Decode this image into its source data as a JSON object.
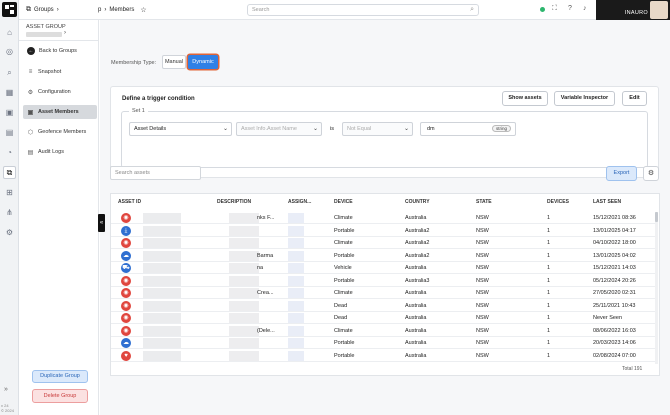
{
  "app": {
    "version": "v 24",
    "copyright": "© 2024"
  },
  "topbar": {
    "breadcrumb_groups": "Groups",
    "breadcrumb_partial": "p",
    "breadcrumb_members": "Members",
    "search_placeholder": "Search",
    "user_name": "INAURO"
  },
  "sidebar": {
    "asset_group_label": "ASSET GROUP",
    "items": [
      {
        "label": "Back to Groups"
      },
      {
        "label": "Snapshot"
      },
      {
        "label": "Configuration"
      },
      {
        "label": "Asset Members"
      },
      {
        "label": "Geofence Members"
      },
      {
        "label": "Audit Logs"
      }
    ],
    "duplicate_label": "Duplicate Group",
    "delete_label": "Delete Group"
  },
  "membership": {
    "label": "Membership Type:",
    "manual": "Manual",
    "dynamic": "Dynamic"
  },
  "trigger": {
    "title": "Define a trigger condition",
    "show_assets": "Show assets",
    "variable_inspector": "Variable Inspector",
    "edit": "Edit",
    "set_label": "Set 1",
    "field_select": "Asset Details",
    "subfield_select": "Asset Info.Asset Name",
    "is_label": "is",
    "operator_select": "Not Equal",
    "value": "dm",
    "value_type": "string"
  },
  "assets": {
    "search_placeholder": "Search assets",
    "export_label": "Export",
    "columns": [
      "ASSET ID",
      "DESCRIPTION",
      "ASSIGN...",
      "DEVICE",
      "COUNTRY",
      "STATE",
      "DEVICES",
      "LAST SEEN"
    ],
    "rows": [
      {
        "desc": "nks F...",
        "device": "Climate",
        "country": "Australia",
        "state": "NSW",
        "devices": "1",
        "last_seen": "15/12/2021 08:36",
        "icon": "red-circle"
      },
      {
        "desc": "",
        "device": "Portable",
        "country": "Australia2",
        "state": "NSW",
        "devices": "1",
        "last_seen": "13/01/2025 04:17",
        "icon": "blue-download"
      },
      {
        "desc": "",
        "device": "Climate",
        "country": "Australia2",
        "state": "NSW",
        "devices": "1",
        "last_seen": "04/10/2022 18:00",
        "icon": "red-circle"
      },
      {
        "desc": "Barma",
        "device": "Portable",
        "country": "Australia2",
        "state": "NSW",
        "devices": "1",
        "last_seen": "13/01/2025 04:02",
        "icon": "blue-cloud"
      },
      {
        "desc": "na",
        "device": "Vehicle",
        "country": "Australia",
        "state": "NSW",
        "devices": "1",
        "last_seen": "15/12/2021 14:03",
        "icon": "blue-truck"
      },
      {
        "desc": "",
        "device": "Portable",
        "country": "Australia3",
        "state": "NSW",
        "devices": "1",
        "last_seen": "05/12/2024 20:26",
        "icon": "red-circle"
      },
      {
        "desc": "Crea...",
        "device": "Climate",
        "country": "Australia",
        "state": "NSW",
        "devices": "1",
        "last_seen": "27/05/2020 02:31",
        "icon": "red-circle"
      },
      {
        "desc": "",
        "device": "Dead",
        "country": "Australia",
        "state": "NSW",
        "devices": "1",
        "last_seen": "25/11/2021 10:43",
        "icon": "red-circle"
      },
      {
        "desc": "",
        "device": "Dead",
        "country": "Australia",
        "state": "NSW",
        "devices": "1",
        "last_seen": "Never Seen",
        "icon": "red-circle"
      },
      {
        "desc": "(Dele...",
        "device": "Climate",
        "country": "Australia",
        "state": "NSW",
        "devices": "1",
        "last_seen": "08/06/2022 16:03",
        "icon": "red-circle"
      },
      {
        "desc": "",
        "device": "Portable",
        "country": "Australia",
        "state": "NSW",
        "devices": "1",
        "last_seen": "20/03/2023 14:06",
        "icon": "blue-cloud"
      },
      {
        "desc": "",
        "device": "Portable",
        "country": "Australia",
        "state": "NSW",
        "devices": "1",
        "last_seen": "02/08/2024 07:00",
        "icon": "red-heart"
      }
    ],
    "total": "Total 191"
  },
  "colors": {
    "accent": "#2f80e6",
    "danger": "#c83a3a",
    "online": "#2db66e"
  }
}
